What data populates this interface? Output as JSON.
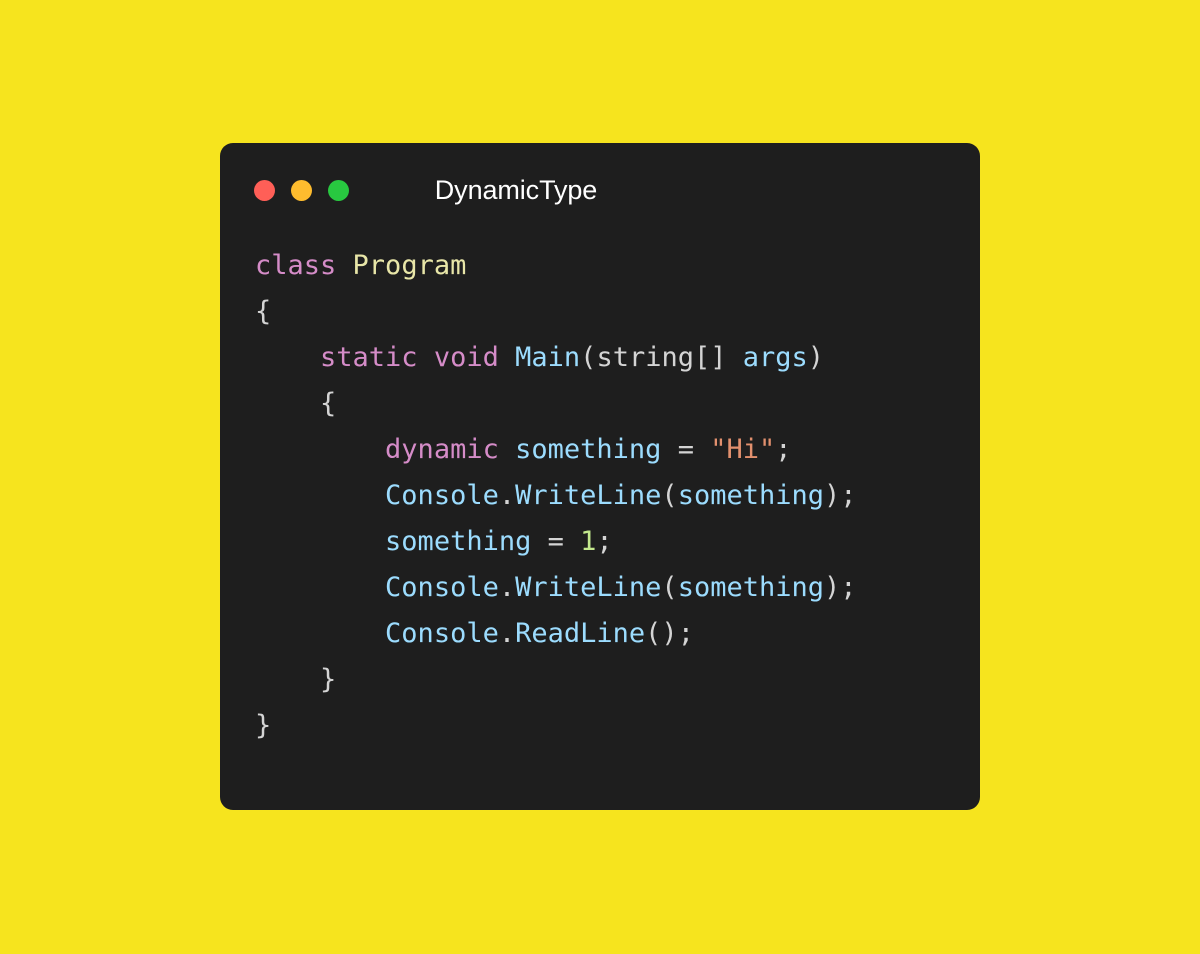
{
  "page": {
    "background_color": "#F6E41E"
  },
  "window": {
    "title": "DynamicType",
    "background_color": "#1E1E1E",
    "traffic_lights": [
      {
        "name": "close",
        "color": "#FF5F57"
      },
      {
        "name": "minimize",
        "color": "#FEBC2E"
      },
      {
        "name": "maximize",
        "color": "#28C840"
      }
    ]
  },
  "code": {
    "language": "csharp",
    "lines": [
      {
        "index": 1,
        "text": "class Program",
        "tokens": [
          {
            "t": "class",
            "k": "keyword"
          },
          {
            "t": " ",
            "k": "plain"
          },
          {
            "t": "Program",
            "k": "type"
          }
        ]
      },
      {
        "index": 2,
        "text": "{",
        "tokens": [
          {
            "t": "{",
            "k": "punct"
          }
        ]
      },
      {
        "index": 3,
        "text": "    static void Main(string[] args)",
        "tokens": [
          {
            "t": "    ",
            "k": "plain"
          },
          {
            "t": "static",
            "k": "keyword"
          },
          {
            "t": " ",
            "k": "plain"
          },
          {
            "t": "void",
            "k": "keyword"
          },
          {
            "t": " ",
            "k": "plain"
          },
          {
            "t": "Main",
            "k": "func"
          },
          {
            "t": "(",
            "k": "punct"
          },
          {
            "t": "string[]",
            "k": "plain"
          },
          {
            "t": " ",
            "k": "plain"
          },
          {
            "t": "args",
            "k": "ident"
          },
          {
            "t": ")",
            "k": "punct"
          }
        ]
      },
      {
        "index": 4,
        "text": "    {",
        "tokens": [
          {
            "t": "    ",
            "k": "plain"
          },
          {
            "t": "{",
            "k": "punct"
          }
        ]
      },
      {
        "index": 5,
        "text": "        dynamic something = \"Hi\";",
        "tokens": [
          {
            "t": "        ",
            "k": "plain"
          },
          {
            "t": "dynamic",
            "k": "keyword"
          },
          {
            "t": " ",
            "k": "plain"
          },
          {
            "t": "something",
            "k": "ident"
          },
          {
            "t": " ",
            "k": "plain"
          },
          {
            "t": "=",
            "k": "punct"
          },
          {
            "t": " ",
            "k": "plain"
          },
          {
            "t": "\"Hi\"",
            "k": "string"
          },
          {
            "t": ";",
            "k": "punct"
          }
        ]
      },
      {
        "index": 6,
        "text": "        Console.WriteLine(something);",
        "tokens": [
          {
            "t": "        ",
            "k": "plain"
          },
          {
            "t": "Console",
            "k": "func"
          },
          {
            "t": ".",
            "k": "punct"
          },
          {
            "t": "WriteLine",
            "k": "func"
          },
          {
            "t": "(",
            "k": "punct"
          },
          {
            "t": "something",
            "k": "ident"
          },
          {
            "t": ")",
            "k": "punct"
          },
          {
            "t": ";",
            "k": "punct"
          }
        ]
      },
      {
        "index": 7,
        "text": "        something = 1;",
        "tokens": [
          {
            "t": "        ",
            "k": "plain"
          },
          {
            "t": "something",
            "k": "ident"
          },
          {
            "t": " ",
            "k": "plain"
          },
          {
            "t": "=",
            "k": "punct"
          },
          {
            "t": " ",
            "k": "plain"
          },
          {
            "t": "1",
            "k": "number"
          },
          {
            "t": ";",
            "k": "punct"
          }
        ]
      },
      {
        "index": 8,
        "text": "        Console.WriteLine(something);",
        "tokens": [
          {
            "t": "        ",
            "k": "plain"
          },
          {
            "t": "Console",
            "k": "func"
          },
          {
            "t": ".",
            "k": "punct"
          },
          {
            "t": "WriteLine",
            "k": "func"
          },
          {
            "t": "(",
            "k": "punct"
          },
          {
            "t": "something",
            "k": "ident"
          },
          {
            "t": ")",
            "k": "punct"
          },
          {
            "t": ";",
            "k": "punct"
          }
        ]
      },
      {
        "index": 9,
        "text": "        Console.ReadLine();",
        "tokens": [
          {
            "t": "        ",
            "k": "plain"
          },
          {
            "t": "Console",
            "k": "func"
          },
          {
            "t": ".",
            "k": "punct"
          },
          {
            "t": "ReadLine",
            "k": "func"
          },
          {
            "t": "(",
            "k": "punct"
          },
          {
            "t": ")",
            "k": "punct"
          },
          {
            "t": ";",
            "k": "punct"
          }
        ]
      },
      {
        "index": 10,
        "text": "    }",
        "tokens": [
          {
            "t": "    ",
            "k": "plain"
          },
          {
            "t": "}",
            "k": "punct"
          }
        ]
      },
      {
        "index": 11,
        "text": "}",
        "tokens": [
          {
            "t": "}",
            "k": "punct"
          }
        ]
      }
    ]
  },
  "colors": {
    "keyword": "#D58CC8",
    "type": "#E8E6A8",
    "func": "#9CDCFE",
    "ident": "#9CDCFE",
    "plain": "#D4D4D4",
    "string": "#E2906E",
    "number": "#C3E88D",
    "punct": "#D4D4D4"
  }
}
